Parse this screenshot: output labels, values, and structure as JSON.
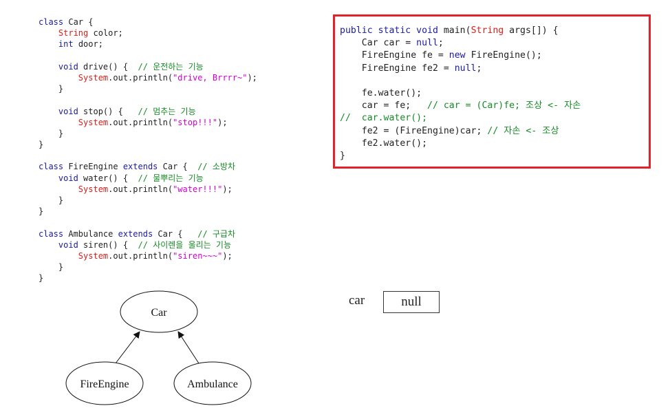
{
  "left_code": [
    [
      {
        "t": "class Car {",
        "c": "kw2"
      }
    ],
    [
      {
        "t": "    ",
        "c": "pl"
      },
      {
        "t": "String",
        "c": "ty"
      },
      {
        "t": " color;",
        "c": "pl"
      }
    ],
    [
      {
        "t": "    ",
        "c": "pl"
      },
      {
        "t": "int",
        "c": "kw"
      },
      {
        "t": " door;",
        "c": "pl"
      }
    ],
    [],
    [
      {
        "t": "    ",
        "c": "pl"
      },
      {
        "t": "void",
        "c": "kw"
      },
      {
        "t": " drive() {  ",
        "c": "pl"
      },
      {
        "t": "// 운전하는 기능",
        "c": "cm"
      }
    ],
    [
      {
        "t": "        ",
        "c": "pl"
      },
      {
        "t": "System",
        "c": "ty"
      },
      {
        "t": ".out.println(",
        "c": "pl"
      },
      {
        "t": "\"drive, Brrrr~\"",
        "c": "st"
      },
      {
        "t": ");",
        "c": "pl"
      }
    ],
    [
      {
        "t": "    }",
        "c": "pl"
      }
    ],
    [],
    [
      {
        "t": "    ",
        "c": "pl"
      },
      {
        "t": "void",
        "c": "kw"
      },
      {
        "t": " stop() {   ",
        "c": "pl"
      },
      {
        "t": "// 멈추는 기능",
        "c": "cm"
      }
    ],
    [
      {
        "t": "        ",
        "c": "pl"
      },
      {
        "t": "System",
        "c": "ty"
      },
      {
        "t": ".out.println(",
        "c": "pl"
      },
      {
        "t": "\"stop!!!\"",
        "c": "st"
      },
      {
        "t": ");",
        "c": "pl"
      }
    ],
    [
      {
        "t": "    }",
        "c": "pl"
      }
    ],
    [
      {
        "t": "}",
        "c": "pl"
      }
    ],
    [],
    [
      {
        "t": "class",
        "c": "kw"
      },
      {
        "t": " FireEngine ",
        "c": "pl"
      },
      {
        "t": "extends",
        "c": "kw"
      },
      {
        "t": " Car {  ",
        "c": "pl"
      },
      {
        "t": "// 소방차",
        "c": "cm"
      }
    ],
    [
      {
        "t": "    ",
        "c": "pl"
      },
      {
        "t": "void",
        "c": "kw"
      },
      {
        "t": " water() {  ",
        "c": "pl"
      },
      {
        "t": "// 물뿌리는 기능",
        "c": "cm"
      }
    ],
    [
      {
        "t": "        ",
        "c": "pl"
      },
      {
        "t": "System",
        "c": "ty"
      },
      {
        "t": ".out.println(",
        "c": "pl"
      },
      {
        "t": "\"water!!!\"",
        "c": "st"
      },
      {
        "t": ");",
        "c": "pl"
      }
    ],
    [
      {
        "t": "    }",
        "c": "pl"
      }
    ],
    [
      {
        "t": "}",
        "c": "pl"
      }
    ],
    [],
    [
      {
        "t": "class",
        "c": "kw"
      },
      {
        "t": " Ambulance ",
        "c": "pl"
      },
      {
        "t": "extends",
        "c": "kw"
      },
      {
        "t": " Car {   ",
        "c": "pl"
      },
      {
        "t": "// 구급차",
        "c": "cm"
      }
    ],
    [
      {
        "t": "    ",
        "c": "pl"
      },
      {
        "t": "void",
        "c": "kw"
      },
      {
        "t": " siren() {  ",
        "c": "pl"
      },
      {
        "t": "// 사이렌을 울리는 기능",
        "c": "cm"
      }
    ],
    [
      {
        "t": "        ",
        "c": "pl"
      },
      {
        "t": "System",
        "c": "ty"
      },
      {
        "t": ".out.println(",
        "c": "pl"
      },
      {
        "t": "\"siren~~~\"",
        "c": "st"
      },
      {
        "t": ");",
        "c": "pl"
      }
    ],
    [
      {
        "t": "    }",
        "c": "pl"
      }
    ],
    [
      {
        "t": "}",
        "c": "pl"
      }
    ]
  ],
  "main_code": [
    [
      {
        "t": "public static void",
        "c": "kw"
      },
      {
        "t": " main(",
        "c": "pl"
      },
      {
        "t": "String",
        "c": "ty"
      },
      {
        "t": " args[]) {",
        "c": "pl"
      }
    ],
    [
      {
        "t": "    Car car = ",
        "c": "pl"
      },
      {
        "t": "null",
        "c": "kw"
      },
      {
        "t": ";",
        "c": "pl"
      }
    ],
    [
      {
        "t": "    FireEngine fe = ",
        "c": "pl"
      },
      {
        "t": "new",
        "c": "kw"
      },
      {
        "t": " FireEngine();",
        "c": "pl"
      }
    ],
    [
      {
        "t": "    FireEngine fe2 = ",
        "c": "pl"
      },
      {
        "t": "null",
        "c": "kw"
      },
      {
        "t": ";",
        "c": "pl"
      }
    ],
    [],
    [
      {
        "t": "    fe.water();",
        "c": "pl"
      }
    ],
    [
      {
        "t": "    car = fe;   ",
        "c": "pl"
      },
      {
        "t": "// car = (Car)fe; 조상 <- 자손",
        "c": "cm"
      }
    ],
    [
      {
        "t": "//  car.water();",
        "c": "cm"
      }
    ],
    [
      {
        "t": "    fe2 = (FireEngine)car; ",
        "c": "pl"
      },
      {
        "t": "// 자손 <- 조상",
        "c": "cm"
      }
    ],
    [
      {
        "t": "    fe2.water();",
        "c": "pl"
      }
    ],
    [
      {
        "t": "}",
        "c": "pl"
      }
    ]
  ],
  "variable": {
    "name": "car",
    "value": "null"
  },
  "hierarchy": {
    "parent": "Car",
    "children": [
      "FireEngine",
      "Ambulance"
    ]
  },
  "colors": {
    "keyword": "#1a1aa6",
    "type": "#d8201c",
    "string": "#d000d0",
    "comment": "#158a25",
    "highlight_border": "#e4202a"
  }
}
